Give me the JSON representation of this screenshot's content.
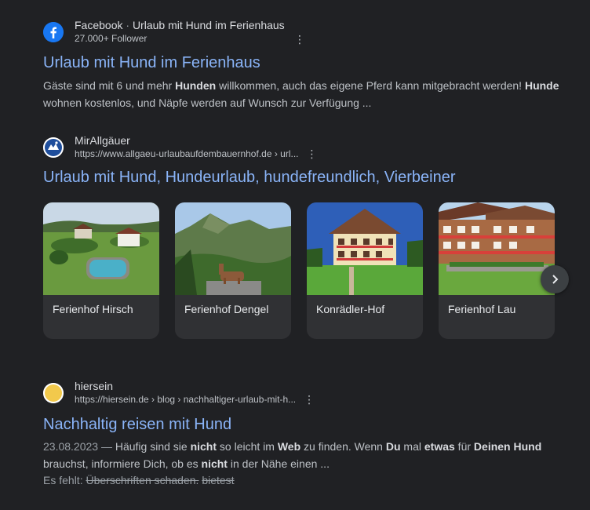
{
  "results": [
    {
      "source_name": "Facebook",
      "source_separator": " · ",
      "source_page": "Urlaub mit Hund im Ferienhaus",
      "followers": "27.000+ Follower",
      "title": "Urlaub mit Hund im Ferienhaus",
      "snippet": [
        {
          "t": "Gäste sind mit 6 und mehr ",
          "b": false
        },
        {
          "t": "Hunden",
          "b": true
        },
        {
          "t": " willkommen, auch das eigene Pferd kann mitgebracht werden! ",
          "b": false
        },
        {
          "t": "Hunde",
          "b": true
        },
        {
          "t": " wohnen kostenlos, und Näpfe werden auf Wunsch zur Verfügung ...",
          "b": false
        }
      ],
      "favicon": "facebook-icon"
    },
    {
      "source_name": "MirAllgäuer",
      "url": "https://www.allgaeu-urlaubaufdembauernhof.de › url...",
      "title": "Urlaub mit Hund, Hundeurlaub, hundefreundlich, Vierbeiner",
      "favicon": "mirallgaeuer-logo-icon",
      "image_cards": [
        {
          "label": "Ferienhof Hirsch"
        },
        {
          "label": "Ferienhof Dengel"
        },
        {
          "label": "Konrädler-Hof"
        },
        {
          "label": "Ferienhof Lau"
        }
      ],
      "carousel_next_icon": "chevron-right-icon"
    },
    {
      "source_name": "hiersein",
      "url": "https://hiersein.de › blog › nachhaltiger-urlaub-mit-h...",
      "title": "Nachhaltig reisen mit Hund",
      "date": "23.08.2023",
      "date_separator": " — ",
      "snippet": [
        {
          "t": "Häufig sind sie ",
          "b": false
        },
        {
          "t": "nicht",
          "b": true
        },
        {
          "t": " so leicht im ",
          "b": false
        },
        {
          "t": "Web",
          "b": true
        },
        {
          "t": " zu finden. Wenn ",
          "b": false
        },
        {
          "t": "Du",
          "b": true
        },
        {
          "t": " mal ",
          "b": false
        },
        {
          "t": "etwas",
          "b": true
        },
        {
          "t": " für ",
          "b": false
        },
        {
          "t": "Deinen Hund",
          "b": true
        },
        {
          "t": " brauchst, informiere Dich, ob es ",
          "b": false
        },
        {
          "t": "nicht",
          "b": true
        },
        {
          "t": " in der Nähe einen ...",
          "b": false
        }
      ],
      "missing_label": "Es fehlt: ",
      "missing_terms": [
        "Überschriften schaden.",
        "bietest"
      ],
      "favicon": "yellow-circle-icon"
    }
  ],
  "colors": {
    "background": "#202124",
    "link": "#8ab4f8",
    "text": "#bdc1c6",
    "card_bg": "#303134"
  }
}
